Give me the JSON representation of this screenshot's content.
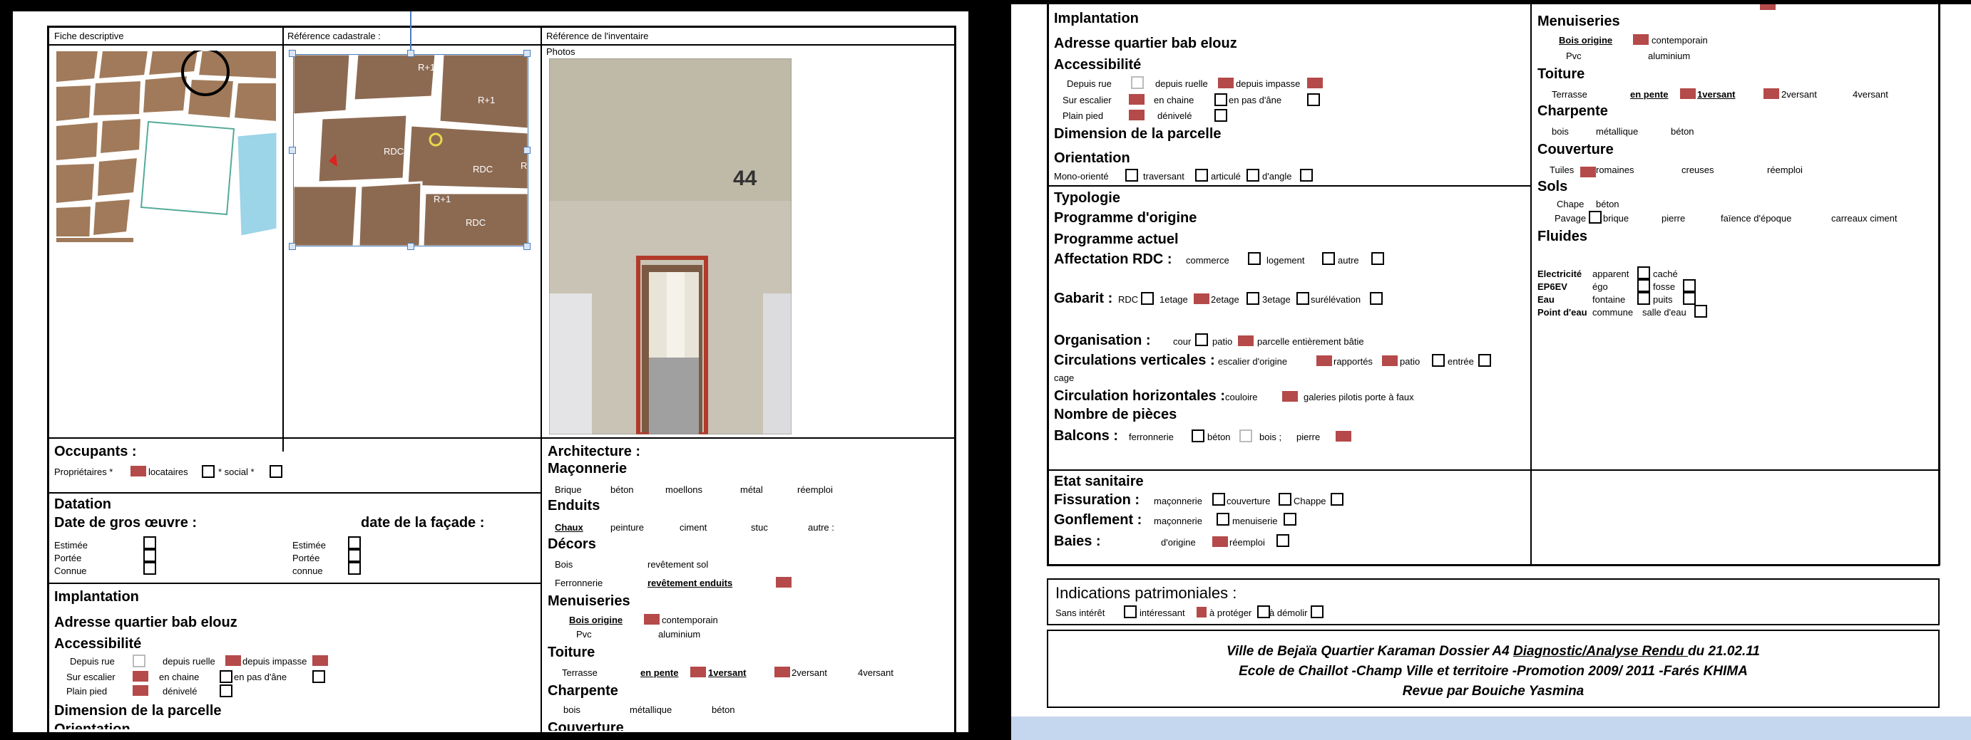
{
  "left": {
    "headers": {
      "fiche": "Fiche descriptive",
      "cadastrale": "Référence cadastrale :",
      "inventaire": "Référence de l'inventaire",
      "photos": "Photos"
    },
    "map_labels": {
      "rplus1_a": "R+1",
      "rplus1_b": "R+1",
      "rdc_a": "RDC",
      "rplus1_c": "R+1",
      "rdc_b": "RDC",
      "rdc_c": "RDC",
      "r": "R"
    },
    "photo_number": "44",
    "occupants": {
      "title": "Occupants :",
      "proprietaires": "Propriétaires *",
      "locataires": "locataires",
      "social": "* social *"
    },
    "datation": {
      "title": "Datation",
      "gros_oeuvre": "Date de gros œuvre :",
      "facade": "date de la façade :",
      "estimee": "Estimée",
      "portee": "Portée",
      "connue": "Connue",
      "estimee2": "Estimée",
      "portee2": "Portée",
      "connue2": "connue"
    },
    "implantation": {
      "title": "Implantation",
      "adresse": "Adresse quartier bab elouz",
      "accessibilite": "Accessibilité",
      "depuis_rue": "Depuis rue",
      "depuis_ruelle": "depuis ruelle",
      "depuis_impasse": "depuis impasse",
      "sur_escalier": "Sur escalier",
      "en_chaine": "en chaine",
      "en_pas": "en pas d'âne",
      "plain_pied": "Plain pied",
      "denivele": "dénivelé",
      "dimension": "Dimension de la parcelle",
      "orientation": "Orientation"
    },
    "architecture": {
      "title": "Architecture :",
      "maconnerie": "Maçonnerie",
      "mac_items": [
        "Brique",
        "béton",
        "moellons",
        "métal",
        "réemploi"
      ],
      "enduits": "Enduits",
      "end_items": [
        "Chaux",
        "peinture",
        "ciment",
        "stuc",
        "autre :"
      ],
      "decors": "Décors",
      "bois": "Bois",
      "rev_sol": "revêtement sol",
      "ferronnerie": "Ferronnerie",
      "rev_enduits": "revêtement enduits",
      "menuiseries": "Menuiseries",
      "bois_origine": "Bois origine",
      "contemporain": "contemporain",
      "pvc": "Pvc",
      "aluminium": "aluminium",
      "toiture": "Toiture",
      "terrasse": "Terrasse",
      "en_pente": "en pente",
      "versant1": "1versant",
      "versant2": "2versant",
      "versant4": "4versant",
      "charpente": "Charpente",
      "ch_items": [
        "bois",
        "métallique",
        "béton"
      ],
      "couverture": "Couverture"
    }
  },
  "right": {
    "implantation": {
      "title": "Implantation",
      "adresse": "Adresse quartier bab elouz",
      "accessibilite": "Accessibilité",
      "depuis_rue": "Depuis rue",
      "depuis_ruelle": "depuis ruelle",
      "depuis_impasse": "depuis impasse",
      "sur_escalier": "Sur escalier",
      "en_chaine": "en chaine",
      "en_pas": "en pas d'âne",
      "plain_pied": "Plain pied",
      "denivele": "dénivelé",
      "dimension": "Dimension de la parcelle",
      "orientation": "Orientation",
      "mono": "Mono-orienté",
      "traversant": "traversant",
      "articule": "articulé",
      "dangle": "d'angle"
    },
    "typologie": {
      "title": "Typologie",
      "prog_origine": "Programme d'origine",
      "prog_actuel": "Programme actuel",
      "affectation": "Affectation RDC :",
      "commerce": "commerce",
      "logement": "logement",
      "autre": "autre",
      "gabarit": "Gabarit :",
      "rdc": "RDC",
      "etage1": "1etage",
      "etage2": "2etage",
      "etage3": "3etage",
      "surelevation": "surélévation",
      "organisation": "Organisation :",
      "cour": "cour",
      "patio": "patio",
      "parcelle": "parcelle entièrement bâtie",
      "circ_vert": "Circulations verticales :",
      "escalier_origine": "escalier d'origine",
      "rapportes": "rapportés",
      "patio2": "patio",
      "entree": "entrée",
      "cage": "cage",
      "circ_horiz": "Circulation horizontales :",
      "couloire": "couloire",
      "galeries": "galeries pilotis porte à faux",
      "nb_pieces": "Nombre de pièces",
      "balcons": "Balcons :",
      "ferronnerie": "ferronnerie",
      "beton": "béton",
      "bois": "bois ;",
      "pierre": "pierre"
    },
    "etat": {
      "title": "Etat sanitaire",
      "fissuration": "Fissuration :",
      "maconnerie": "maçonnerie",
      "couverture": "couverture",
      "chappe": "Chappe",
      "gonflement": "Gonflement :",
      "maconnerie2": "maçonnerie",
      "menuiserie": "menuiserie",
      "baies": "Baies :",
      "dorigine": "d'origine",
      "reemploi": "réemploi"
    },
    "menuiseries": {
      "title": "Menuiseries",
      "bois_origine": "Bois origine",
      "contemporain": "contemporain",
      "pvc": "Pvc",
      "aluminium": "aluminium",
      "toiture": "Toiture",
      "terrasse": "Terrasse",
      "en_pente": "en pente",
      "versant1": "1versant",
      "versant2": "2versant",
      "versant4": "4versant",
      "charpente": "Charpente",
      "bois": "bois",
      "metallique": "métallique",
      "beton": "béton",
      "couverture": "Couverture",
      "tuiles": "Tuiles",
      "romaines": "romaines",
      "creuses": "creuses",
      "reemploi": "réemploi",
      "sols": "Sols",
      "chape": "Chape",
      "beton2": "béton",
      "pavage": "Pavage",
      "brique": "brique",
      "pierre": "pierre",
      "faience": "faïence d'époque",
      "carreaux": "carreaux ciment",
      "fluides": "Fluides"
    },
    "fluides": {
      "electricite": "Electricité",
      "apparent": "apparent",
      "cache": "caché",
      "ep6ev": "EP6EV",
      "ego": "égo",
      "fosse": "fosse",
      "eau": "Eau",
      "fontaine": "fontaine",
      "puits": "puits",
      "point_eau": "Point d'eau",
      "commune": "commune",
      "salle_eau": "salle d'eau"
    },
    "indications": {
      "title": "Indications patrimoniales :",
      "sans_interet": "Sans intérêt",
      "interessant": "intéressant",
      "a_proteger": "à protéger",
      "a_demolir": "à démolir"
    },
    "footer": {
      "line1a": "Ville de Bejaïa Quartier Karaman Dossier A4 ",
      "line1b": "Diagnostic/Analyse Rendu ",
      "line1c": "du 21.02.11",
      "line2": "Ecole de Chaillot -Champ Ville et territoire -Promotion 2009/ 2011 -Farés KHIMA",
      "line3": "Revue par Bouiche Yasmina"
    }
  },
  "colors": {
    "checked": "#b54a4a",
    "taskbar": "#c5d7ee"
  }
}
